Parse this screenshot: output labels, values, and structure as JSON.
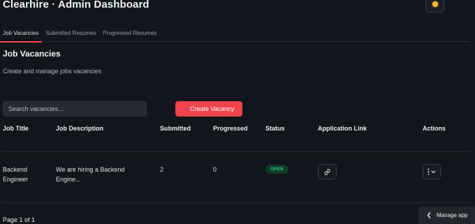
{
  "header": {
    "title": "Clearhire · Admin Dashboard",
    "theme_icon": "sun-icon",
    "accent_color": "#f0444c"
  },
  "tabs": [
    {
      "label": "Job Vacancies",
      "active": true
    },
    {
      "label": "Submitted Resumes",
      "active": false
    },
    {
      "label": "Progressed Resumes",
      "active": false
    }
  ],
  "section": {
    "title": "Job Vacancies",
    "subtitle": "Create and manage jobs vacancies"
  },
  "toolbar": {
    "search_placeholder": "Search vacancies...",
    "create_label": "Create Vacancy",
    "create_icon": "plus-icon"
  },
  "table": {
    "columns": [
      "Job Title",
      "Job Description",
      "Submitted",
      "Progressed",
      "Status",
      "Application Link",
      "Actions"
    ],
    "rows": [
      {
        "title_line1": "Backend",
        "title_line2": "Engineer",
        "desc_line1": "We are hiring a Backend",
        "desc_line2": "Engine...",
        "submitted": "2",
        "progressed": "0",
        "status": "OPEN",
        "status_color": "#2fd37a",
        "link_icon": "link-icon",
        "actions_icon": "more-vertical-chevron-icon"
      }
    ]
  },
  "pagination": {
    "label": "Page 1 of 1"
  },
  "manage_app": {
    "label": "Manage app",
    "icon": "chevron-left-icon"
  }
}
